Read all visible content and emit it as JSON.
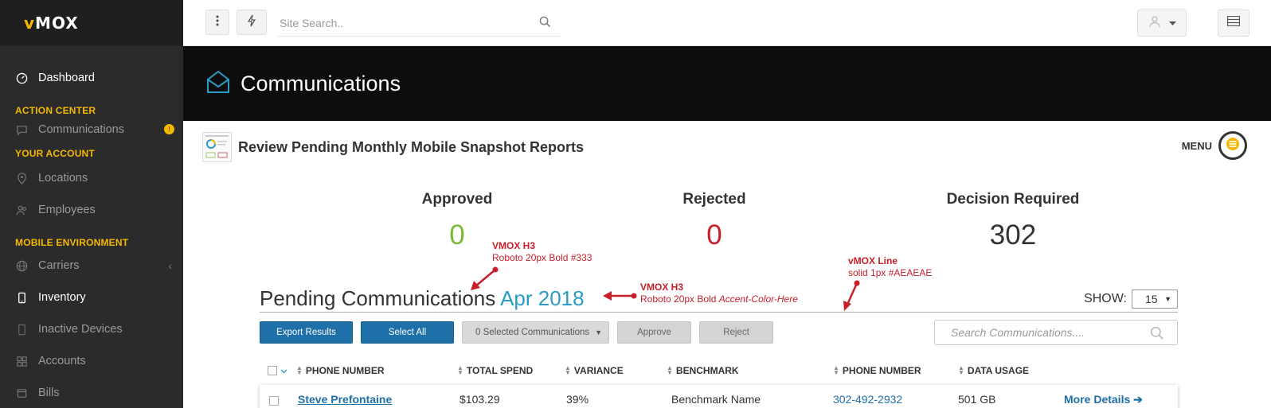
{
  "brand": {
    "logo_v": "v",
    "logo_rest": "MOX"
  },
  "sidebar": {
    "items": [
      {
        "label": "Dashboard"
      },
      {
        "section": "ACTION CENTER"
      },
      {
        "label": "Communications",
        "badge": "!"
      },
      {
        "section": "YOUR ACCOUNT"
      },
      {
        "label": "Locations"
      },
      {
        "label": "Employees"
      },
      {
        "section": "MOBILE ENVIRONMENT"
      },
      {
        "label": "Carriers",
        "chevron": "‹"
      },
      {
        "label": "Inventory"
      },
      {
        "label": "Inactive Devices"
      },
      {
        "label": "Accounts"
      },
      {
        "label": "Bills"
      }
    ]
  },
  "topbar": {
    "search_placeholder": "Site Search.."
  },
  "page": {
    "title": "Communications"
  },
  "report": {
    "title": "Review Pending Monthly Mobile Snapshot Reports",
    "menu_label": "MENU"
  },
  "stats": {
    "approved": {
      "label": "Approved",
      "value": "0",
      "color": "#7cb83a"
    },
    "rejected": {
      "label": "Rejected",
      "value": "0",
      "color": "#c8202a"
    },
    "decision": {
      "label": "Decision Required",
      "value": "302",
      "color": "#333333"
    }
  },
  "annotations": {
    "h3_a_title": "VMOX H3",
    "h3_a_desc": "Roboto 20px Bold #333",
    "h3_b_title": "VMOX H3",
    "h3_b_desc_plain": "Roboto 20px Bold ",
    "h3_b_desc_italic": "Accent-Color-Here",
    "line_title": "vMOX Line",
    "line_desc": "solid 1px #AEAEAE"
  },
  "pending": {
    "title": "Pending Communications",
    "accent_text": "Apr 2018",
    "accent_color": "#2a9bc5",
    "show_label": "SHOW:",
    "show_value": "15"
  },
  "toolbar": {
    "export_label": "Export Results",
    "select_all_label": "Select All",
    "selected_label": "0 Selected Communications",
    "approve_label": "Approve",
    "reject_label": "Reject",
    "search_placeholder": "Search Communications...."
  },
  "table": {
    "headers": [
      "PHONE NUMBER",
      "TOTAL SPEND",
      "VARIANCE",
      "BENCHMARK",
      "PHONE NUMBER",
      "DATA USAGE"
    ],
    "rows": [
      {
        "name": "Steve Prefontaine",
        "total_spend": "$103.29",
        "variance": "39%",
        "benchmark": "Benchmark Name",
        "phone": "302-492-2932",
        "data_usage": "501 GB",
        "details": "More Details"
      }
    ]
  }
}
